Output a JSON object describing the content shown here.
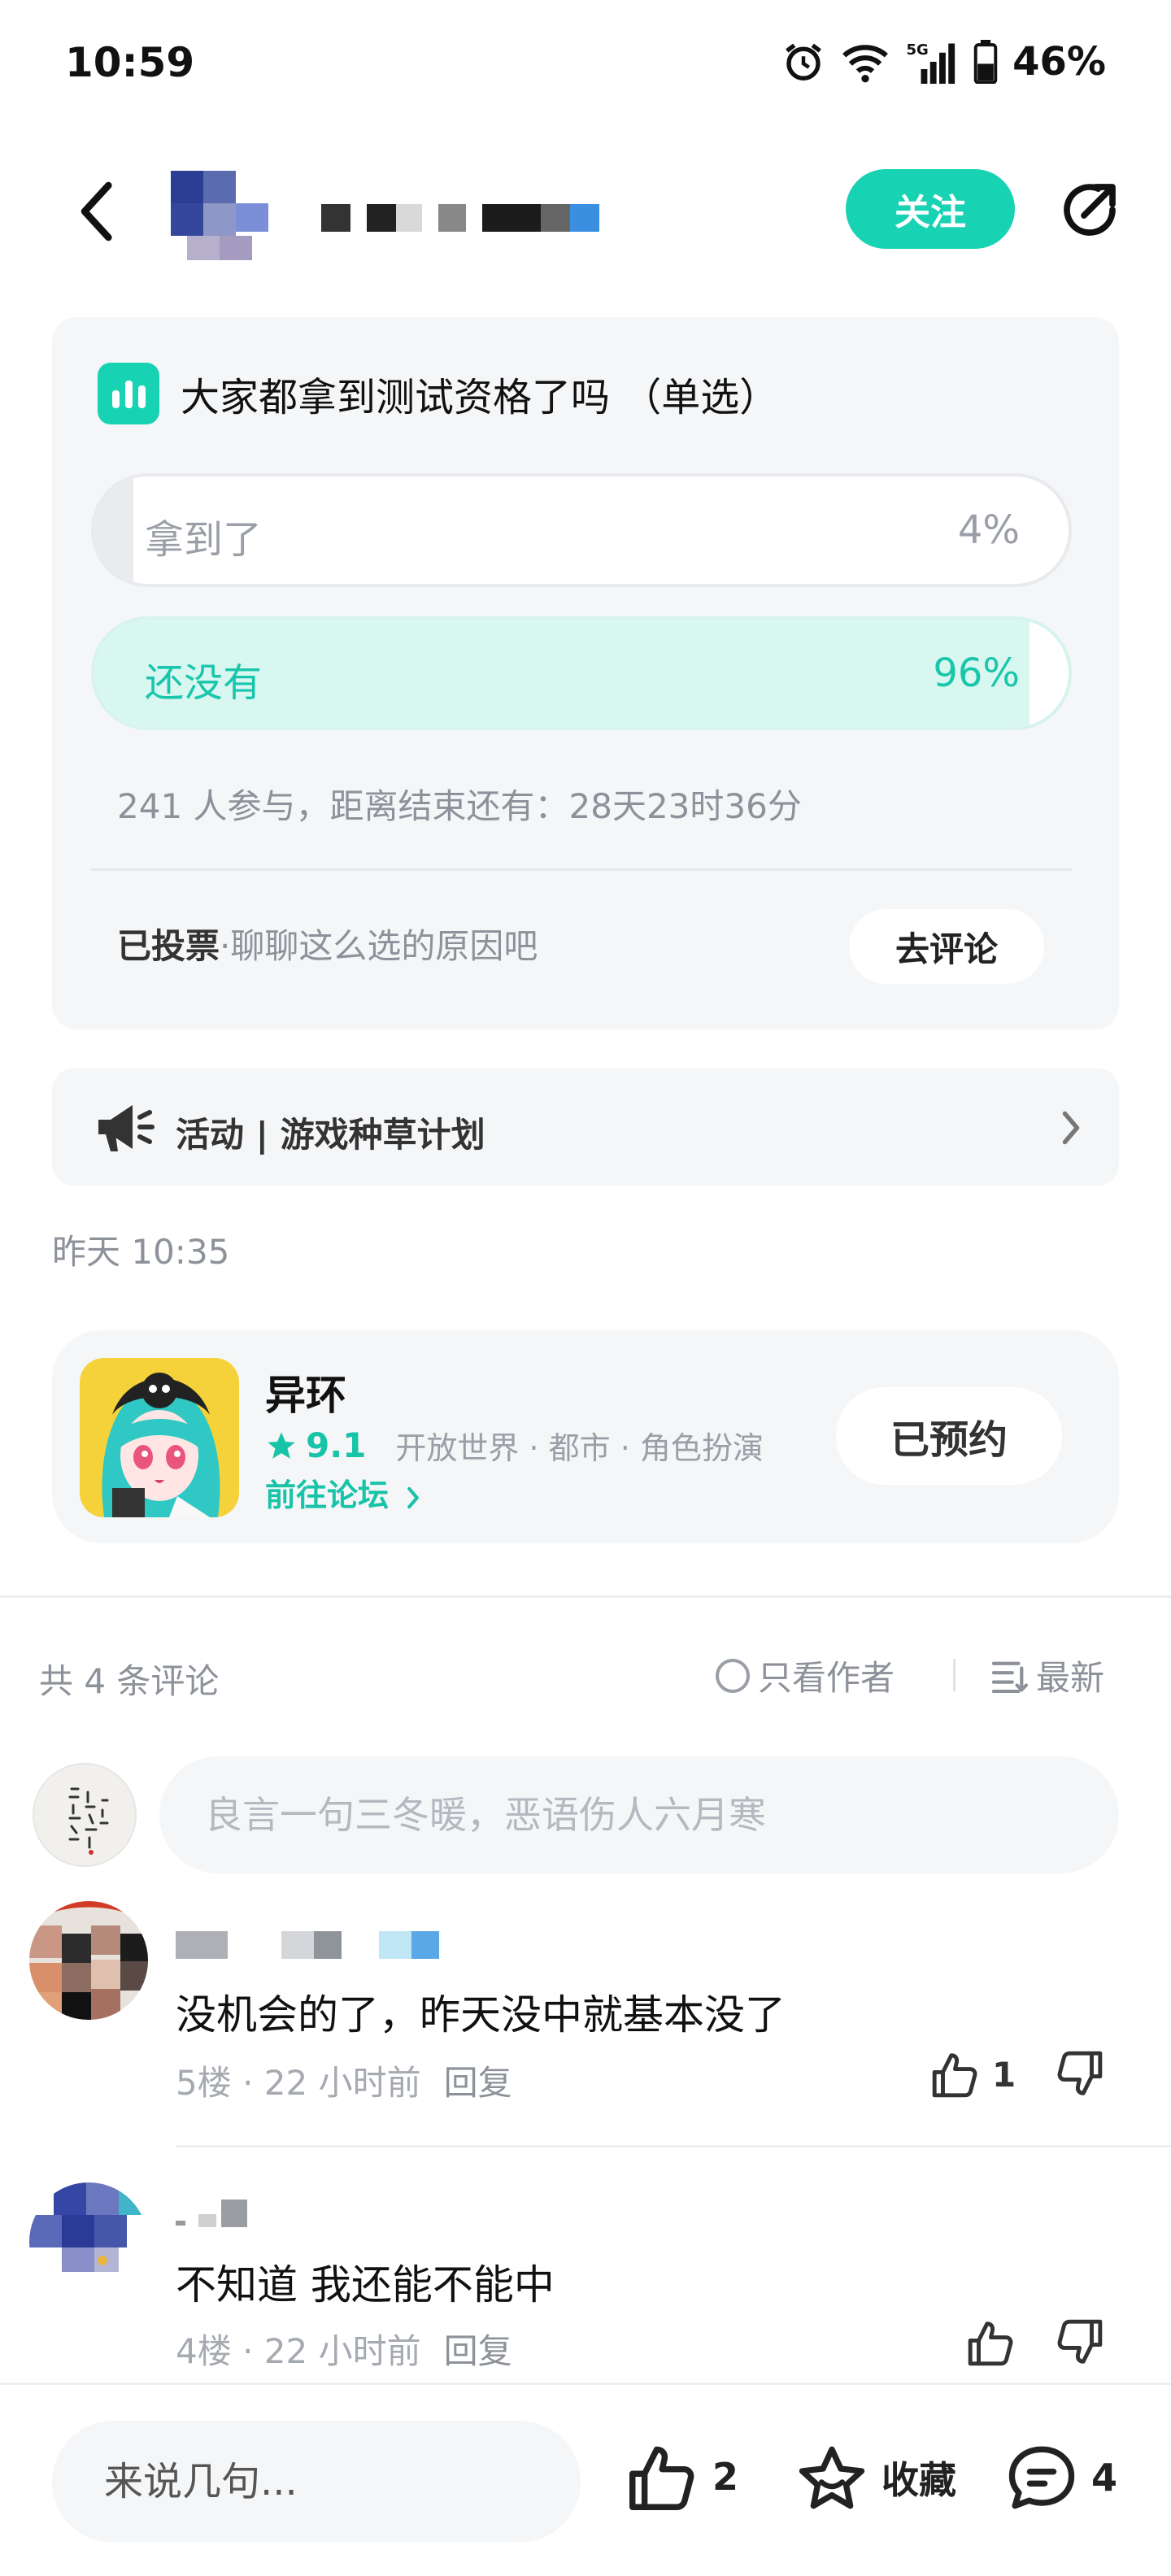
{
  "status_bar": {
    "time": "10:59",
    "battery": "46%",
    "network": "5G"
  },
  "header": {
    "follow_label": "关注"
  },
  "poll": {
    "title": "大家都拿到测试资格了吗 （单选）",
    "options": [
      {
        "label": "拿到了",
        "percent_text": "4%",
        "percent": 4
      },
      {
        "label": "还没有",
        "percent_text": "96%",
        "percent": 96
      }
    ],
    "meta": "241 人参与，距离结束还有：28天23时36分",
    "voted_label": "已投票",
    "voted_sub": "·聊聊这么选的原因吧",
    "comment_button": "去评论"
  },
  "activity": {
    "label": "活动 | 游戏种草计划"
  },
  "post_time": "昨天 10:35",
  "game": {
    "name": "异环",
    "rating": "9.1",
    "tags": "开放世界 · 都市 · 角色扮演",
    "forum_link": "前往论坛",
    "reserve_label": "已预约"
  },
  "comments_header": {
    "count_label": "共 4 条评论",
    "author_only": "只看作者",
    "sort_label": "最新"
  },
  "comment_input_placeholder": "良言一句三冬暖，恶语伤人六月寒",
  "comments": [
    {
      "text": "没机会的了，昨天没中就基本没了",
      "floor": "5楼",
      "time": "22 小时前",
      "reply": "回复",
      "likes": "1"
    },
    {
      "text": "不知道 我还能不能中",
      "floor": "4楼",
      "time": "22 小时前",
      "reply": "回复",
      "likes": ""
    }
  ],
  "bottom_bar": {
    "input_placeholder": "来说几句...",
    "like_count": "2",
    "favorite_label": "收藏",
    "comment_count": "4"
  },
  "colors": {
    "accent": "#18d2b4",
    "text": "#111111",
    "muted": "#8d9199",
    "card_bg": "#f5f6f8"
  },
  "icons": [
    "back-arrow-icon",
    "share-icon",
    "poll-chart-icon",
    "megaphone-icon",
    "chevron-right-icon",
    "star-icon",
    "radio-icon",
    "sort-icon",
    "thumbs-up-icon",
    "thumbs-down-icon",
    "favorite-star-icon",
    "comment-bubble-icon"
  ]
}
